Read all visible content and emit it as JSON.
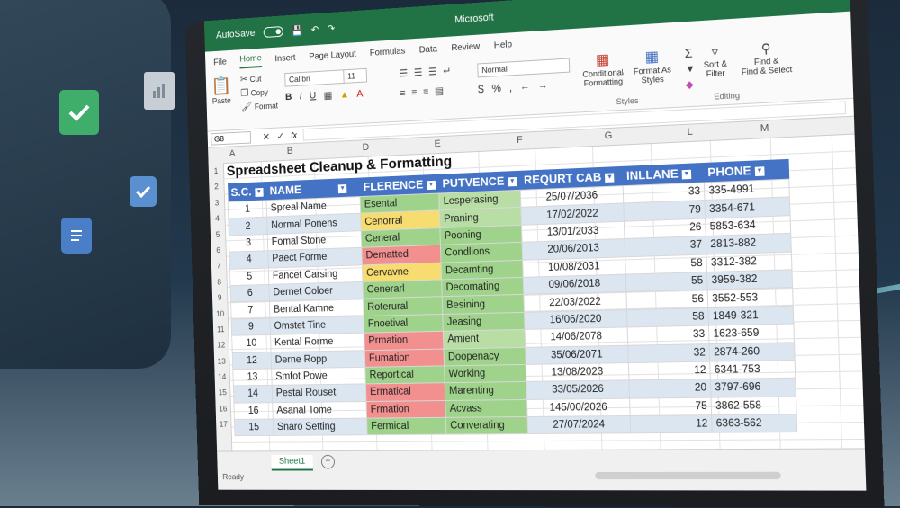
{
  "titlebar": {
    "autosave": "AutoSave",
    "app_title": "Microsoft"
  },
  "menu": [
    "File",
    "Home",
    "Insert",
    "Page Layout",
    "Formulas",
    "Data",
    "Review",
    "Help"
  ],
  "ribbon": {
    "paste": "Paste",
    "cut": "Cut",
    "copy": "Copy",
    "format": "Format",
    "font": "Calibri",
    "font_size": "11",
    "number_format": "Normal",
    "conditional": "Conditional",
    "formatting": "Formatting",
    "format_as": "Format As",
    "styles_btn": "Styles",
    "styles_group": "Styles",
    "editing": "Editing",
    "find": "Find &",
    "select": "Find & Select",
    "filter": "Sort &",
    "filter2": "Filter"
  },
  "formula_bar": {
    "cell": "G8",
    "fx": "fx"
  },
  "column_letters": [
    "A",
    "B",
    "D",
    "E",
    "F",
    "G",
    "L",
    "M"
  ],
  "row_numbers": [
    "1",
    "2",
    "3",
    "4",
    "5",
    "6",
    "7",
    "8",
    "9",
    "10",
    "11",
    "12",
    "13",
    "14",
    "15",
    "16",
    "17"
  ],
  "sheet_title": "Spreadsheet Cleanup & Formatting",
  "table": {
    "headers": [
      "S.C.",
      "NAME",
      "FLERENCE",
      "PUTVENCE",
      "REQURT CAB",
      "INLLANE",
      "PHONE"
    ],
    "rows": [
      {
        "sc": "1",
        "name": "Spreal Name",
        "f": "Esental",
        "fc": "green",
        "p": "Lesperasing",
        "date": "25/07/2036",
        "n": "33",
        "phone": "335-4991"
      },
      {
        "sc": "2",
        "name": "Normal Ponens",
        "f": "Cenorral",
        "fc": "yellow",
        "p": "Praning",
        "date": "17/02/2022",
        "n": "79",
        "phone": "3354-671"
      },
      {
        "sc": "3",
        "name": "Fomal Stone",
        "f": "Ceneral",
        "fc": "green",
        "p": "Pooning",
        "date": "13/01/2033",
        "n": "26",
        "phone": "5853-634"
      },
      {
        "sc": "4",
        "name": "Paect Forme",
        "f": "Dematted",
        "fc": "red",
        "p": "Condlions",
        "date": "20/06/2013",
        "n": "37",
        "phone": "2813-882"
      },
      {
        "sc": "5",
        "name": "Fancet Carsing",
        "f": "Cervavne",
        "fc": "yellow",
        "p": "Decamting",
        "date": "10/08/2031",
        "n": "58",
        "phone": "3312-382"
      },
      {
        "sc": "6",
        "name": "Dernet Coloer",
        "f": "Cenerarl",
        "fc": "green",
        "p": "Decomating",
        "date": "09/06/2018",
        "n": "55",
        "phone": "3959-382"
      },
      {
        "sc": "7",
        "name": "Bental Kamne",
        "f": "Roterural",
        "fc": "green",
        "p": "Besining",
        "date": "22/03/2022",
        "n": "56",
        "phone": "3552-553"
      },
      {
        "sc": "9",
        "name": "Omstet Tine",
        "f": "Fnoetival",
        "fc": "green",
        "p": "Jeasing",
        "date": "16/06/2020",
        "n": "58",
        "phone": "1849-321"
      },
      {
        "sc": "10",
        "name": "Kental Rorme",
        "f": "Prmation",
        "fc": "red",
        "p": "Amient",
        "date": "14/06/2078",
        "n": "33",
        "phone": "1623-659"
      },
      {
        "sc": "12",
        "name": "Derne Ropp",
        "f": "Fumation",
        "fc": "red",
        "p": "Doopenacy",
        "date": "35/06/2071",
        "n": "32",
        "phone": "2874-260"
      },
      {
        "sc": "13",
        "name": "Smfot Powe",
        "f": "Reportical",
        "fc": "green",
        "p": "Working",
        "date": "13/08/2023",
        "n": "12",
        "phone": "6341-753"
      },
      {
        "sc": "14",
        "name": "Pestal Rouset",
        "f": "Ermatical",
        "fc": "red",
        "p": "Marenting",
        "date": "33/05/2026",
        "n": "20",
        "phone": "3797-696"
      },
      {
        "sc": "16",
        "name": "Asanal Tome",
        "f": "Frmation",
        "fc": "red",
        "p": "Acvass",
        "date": "145/00/2026",
        "n": "75",
        "phone": "3862-558"
      },
      {
        "sc": "15",
        "name": "Snaro Setting",
        "f": "Fermical",
        "fc": "green",
        "p": "Converating",
        "date": "27/07/2024",
        "n": "12",
        "phone": "6363-562"
      }
    ]
  },
  "statusbar": {
    "sheet": "Sheet1",
    "add": "+",
    "status": "Ready"
  }
}
